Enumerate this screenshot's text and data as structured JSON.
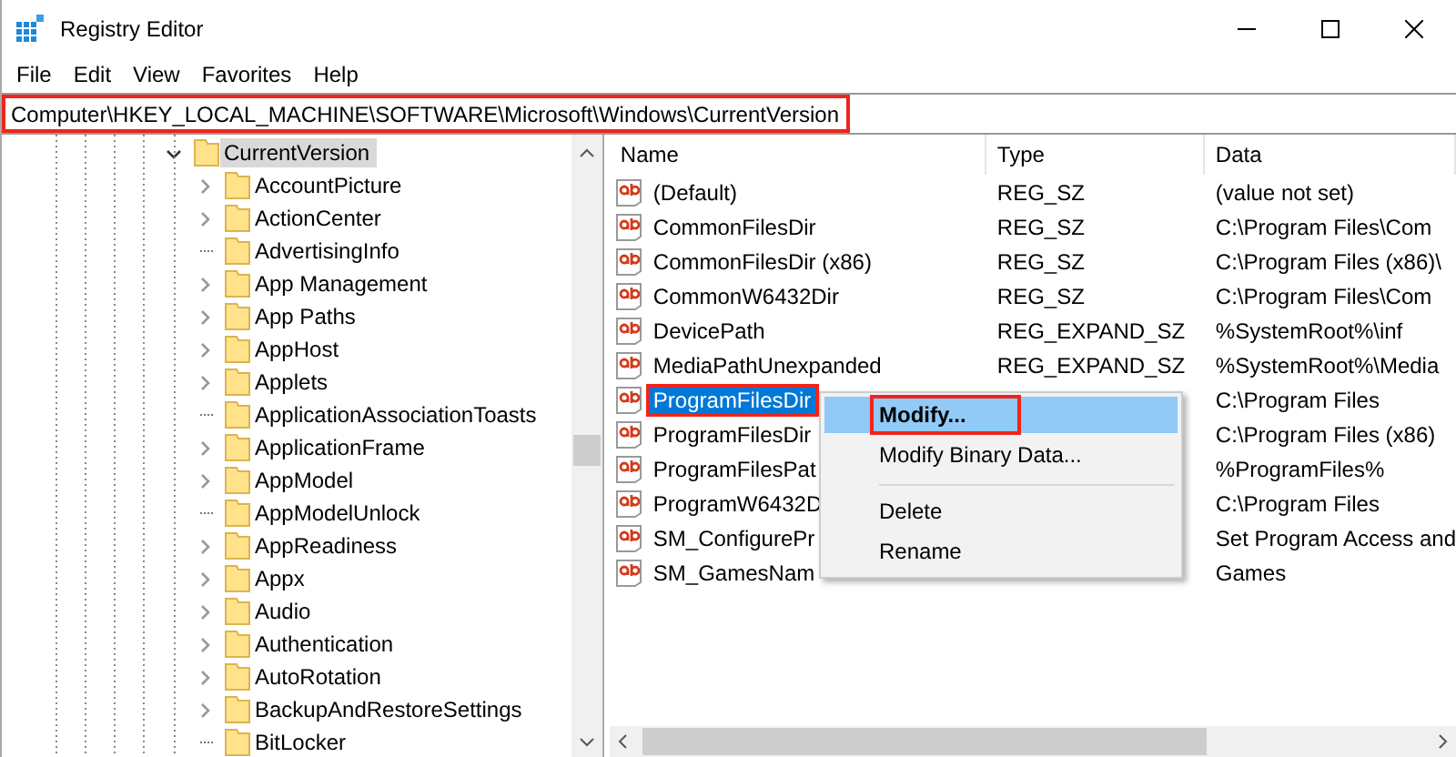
{
  "window": {
    "title": "Registry Editor"
  },
  "menu": [
    "File",
    "Edit",
    "View",
    "Favorites",
    "Help"
  ],
  "address": {
    "value": "Computer\\HKEY_LOCAL_MACHINE\\SOFTWARE\\Microsoft\\Windows\\CurrentVersion",
    "highlighted": true
  },
  "tree": [
    {
      "label": "CurrentVersion",
      "selected": true,
      "expanded": true,
      "children": [
        {
          "label": "AccountPicture",
          "selected": false,
          "has_children": true
        },
        {
          "label": "ActionCenter",
          "selected": false,
          "has_children": true
        },
        {
          "label": "AdvertisingInfo",
          "selected": false,
          "has_children": false
        },
        {
          "label": "App Management",
          "selected": false,
          "has_children": true
        },
        {
          "label": "App Paths",
          "selected": false,
          "has_children": true
        },
        {
          "label": "AppHost",
          "selected": false,
          "has_children": true
        },
        {
          "label": "Applets",
          "selected": false,
          "has_children": true
        },
        {
          "label": "ApplicationAssociationToasts",
          "selected": false,
          "has_children": false
        },
        {
          "label": "ApplicationFrame",
          "selected": false,
          "has_children": true
        },
        {
          "label": "AppModel",
          "selected": false,
          "has_children": true
        },
        {
          "label": "AppModelUnlock",
          "selected": false,
          "has_children": false
        },
        {
          "label": "AppReadiness",
          "selected": false,
          "has_children": true
        },
        {
          "label": "Appx",
          "selected": false,
          "has_children": true
        },
        {
          "label": "Audio",
          "selected": false,
          "has_children": true
        },
        {
          "label": "Authentication",
          "selected": false,
          "has_children": true
        },
        {
          "label": "AutoRotation",
          "selected": false,
          "has_children": true
        },
        {
          "label": "BackupAndRestoreSettings",
          "selected": false,
          "has_children": true
        },
        {
          "label": "BitLocker",
          "selected": false,
          "has_children": false
        }
      ]
    }
  ],
  "columns": [
    "Name",
    "Type",
    "Data"
  ],
  "rows": [
    {
      "name": "(Default)",
      "type": "REG_SZ",
      "data": "(value not set)",
      "selected": false,
      "highlighted": false
    },
    {
      "name": "CommonFilesDir",
      "type": "REG_SZ",
      "data": "C:\\Program Files\\Com",
      "selected": false,
      "highlighted": false
    },
    {
      "name": "CommonFilesDir (x86)",
      "type": "REG_SZ",
      "data": "C:\\Program Files (x86)\\",
      "selected": false,
      "highlighted": false
    },
    {
      "name": "CommonW6432Dir",
      "type": "REG_SZ",
      "data": "C:\\Program Files\\Com",
      "selected": false,
      "highlighted": false
    },
    {
      "name": "DevicePath",
      "type": "REG_EXPAND_SZ",
      "data": "%SystemRoot%\\inf",
      "selected": false,
      "highlighted": false
    },
    {
      "name": "MediaPathUnexpanded",
      "type": "REG_EXPAND_SZ",
      "data": "%SystemRoot%\\Media",
      "selected": false,
      "highlighted": false
    },
    {
      "name": "ProgramFilesDir",
      "data": "C:\\Program Files",
      "selected": true,
      "highlighted": true
    },
    {
      "name": "ProgramFilesDir",
      "data": "C:\\Program Files (x86)",
      "selected": false,
      "highlighted": false
    },
    {
      "name": "ProgramFilesPat",
      "data": "%ProgramFiles%",
      "selected": false,
      "highlighted": false
    },
    {
      "name": "ProgramW6432D",
      "data": "C:\\Program Files",
      "selected": false,
      "highlighted": false
    },
    {
      "name": "SM_ConfigurePr",
      "data": "Set Program Access and",
      "selected": false,
      "highlighted": false
    },
    {
      "name": "SM_GamesNam",
      "data": "Games",
      "selected": false,
      "highlighted": false
    }
  ],
  "context_menu": [
    {
      "kind": "item",
      "label": "Modify...",
      "selected": true,
      "highlighted": true
    },
    {
      "kind": "item",
      "label": "Modify Binary Data...",
      "selected": false,
      "highlighted": false
    },
    {
      "kind": "separator"
    },
    {
      "kind": "item",
      "label": "Delete",
      "selected": false,
      "highlighted": false
    },
    {
      "kind": "item",
      "label": "Rename",
      "selected": false,
      "highlighted": false
    }
  ]
}
